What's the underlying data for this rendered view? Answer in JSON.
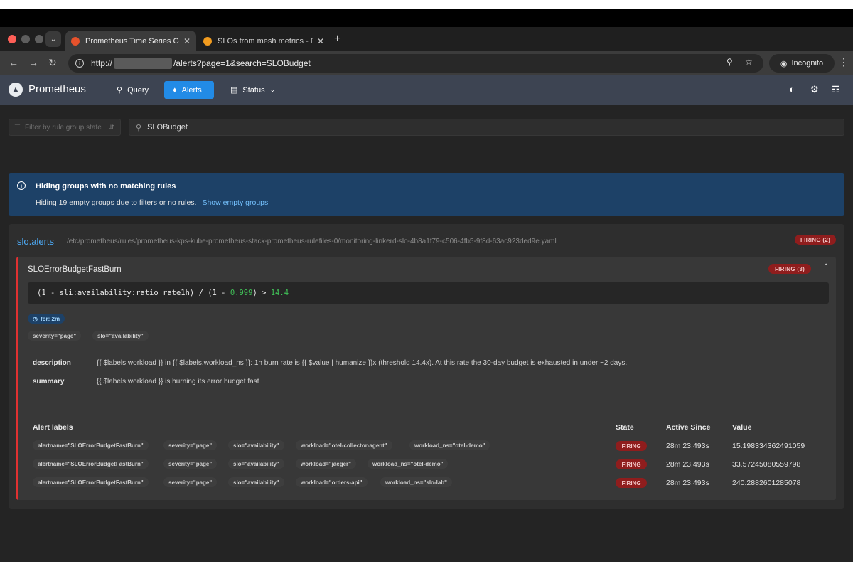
{
  "browser": {
    "tabs": [
      {
        "title": "Prometheus Time Series Colle",
        "active": true
      },
      {
        "title": "SLOs from mesh metrics - Da",
        "active": false
      }
    ],
    "url_prefix": "http://",
    "url_suffix": "/alerts?page=1&search=SLOBudget",
    "incognito_label": "Incognito"
  },
  "header": {
    "brand": "Prometheus",
    "nav": {
      "query": "Query",
      "alerts": "Alerts",
      "status": "Status"
    }
  },
  "filters": {
    "rule_group_placeholder": "Filter by rule group state",
    "search_value": "SLOBudget"
  },
  "notice": {
    "title": "Hiding groups with no matching rules",
    "text": "Hiding 19 empty groups due to filters or no rules.",
    "link": "Show empty groups"
  },
  "group": {
    "name": "slo.alerts",
    "file": "/etc/prometheus/rules/prometheus-kps-kube-prometheus-stack-prometheus-rulefiles-0/monitoring-linkerd-slo-4b8a1f79-c506-4fb5-9f8d-63ac923ded9e.yaml",
    "badge": "FIRING (2)"
  },
  "rule": {
    "name": "SLOErrorBudgetFastBurn",
    "badge": "FIRING (3)",
    "expr": {
      "p1": "(1 - sli:availability:ratio_rate1h) / (1 - ",
      "n1": "0.999",
      "p2": ") > ",
      "n2": "14.4"
    },
    "for": "for: 2m",
    "labels": [
      "severity=\"page\"",
      "slo=\"availability\""
    ],
    "annotations": [
      {
        "key": "description",
        "value": "{{ $labels.workload }} in {{ $labels.workload_ns }}: 1h burn rate is {{ $value | humanize }}x (threshold 14.4x). At this rate the 30-day budget is exhausted in under ~2 days."
      },
      {
        "key": "summary",
        "value": "{{ $labels.workload }} is burning its error budget fast"
      }
    ]
  },
  "alerts_table": {
    "headers": {
      "labels": "Alert labels",
      "state": "State",
      "active_since": "Active Since",
      "value": "Value"
    },
    "rows": [
      {
        "labels": [
          "alertname=\"SLOErrorBudgetFastBurn\"",
          "severity=\"page\"",
          "slo=\"availability\"",
          "workload=\"otel-collector-agent\"",
          "workload_ns=\"otel-demo\""
        ],
        "state": "FIRING",
        "active_since": "28m 23.493s",
        "value": "15.198334362491059"
      },
      {
        "labels": [
          "alertname=\"SLOErrorBudgetFastBurn\"",
          "severity=\"page\"",
          "slo=\"availability\"",
          "workload=\"jaeger\"",
          "workload_ns=\"otel-demo\""
        ],
        "state": "FIRING",
        "active_since": "28m 23.493s",
        "value": "33.57245080559798"
      },
      {
        "labels": [
          "alertname=\"SLOErrorBudgetFastBurn\"",
          "severity=\"page\"",
          "slo=\"availability\"",
          "workload=\"orders-api\"",
          "workload_ns=\"slo-lab\""
        ],
        "state": "FIRING",
        "active_since": "28m 23.493s",
        "value": "240.2882601285078"
      }
    ]
  },
  "colors": {
    "firing": "#8f1d1d",
    "accent": "#228be6",
    "rule_border": "#e03131",
    "header_bg": "#3d4452"
  }
}
